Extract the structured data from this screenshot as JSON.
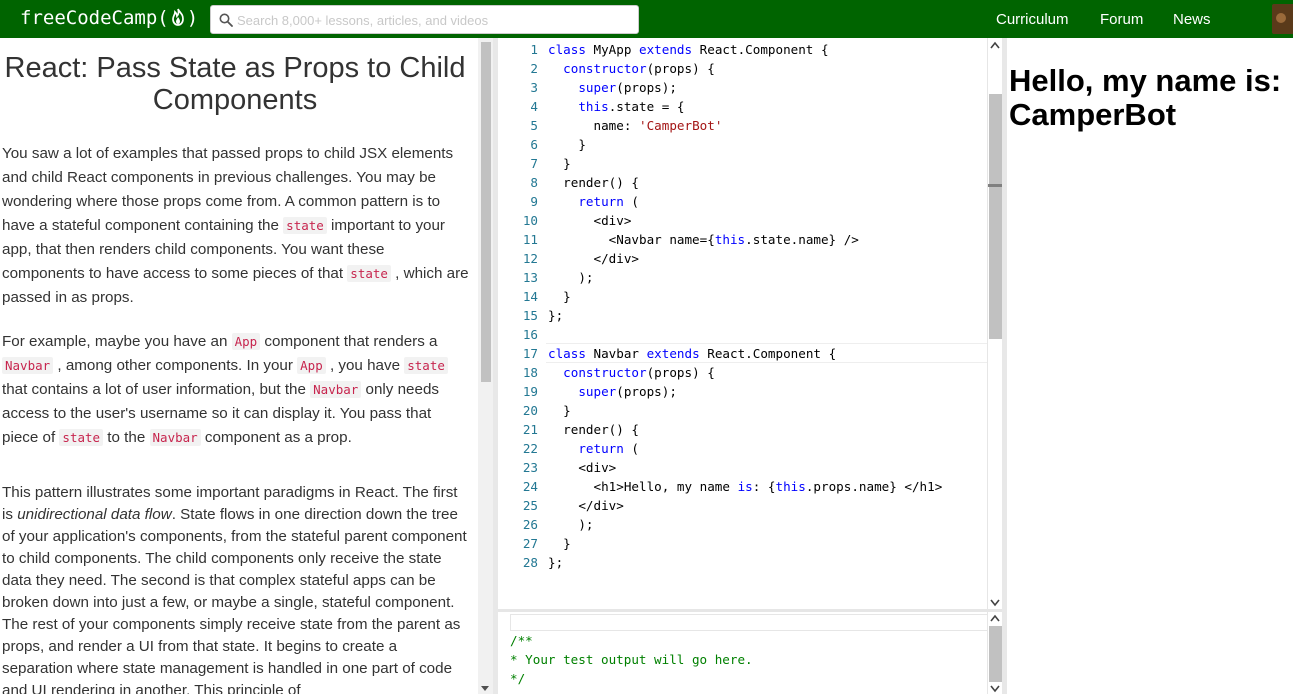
{
  "navbar": {
    "brand": "freeCodeCamp(",
    "brand_close": ")",
    "search_placeholder": "Search 8,000+ lessons, articles, and videos",
    "links": [
      "Curriculum",
      "Forum",
      "News"
    ],
    "colors": {
      "background": "#006400",
      "text": "#ffffff"
    }
  },
  "instructions": {
    "title": "React: Pass State as Props to Child Components",
    "p1": [
      "You saw a lot of examples that passed props to child JSX elements and child React components in previous challenges. You may be wondering where those props come from. A common pattern is to have a stateful component containing the ",
      "state",
      " important to your app, that then renders child components. You want these components to have access to some pieces of that ",
      "state",
      " , which are passed in as props."
    ],
    "p2": [
      "For example, maybe you have an ",
      "App",
      " component that renders a ",
      "Navbar",
      " , among other components. In your ",
      "App",
      " , you have ",
      "state",
      " that contains a lot of user information, but the ",
      "Navbar",
      " only needs access to the user's username so it can display it. You pass that piece of ",
      "state",
      " to the ",
      "Navbar",
      " component as a prop."
    ],
    "p3": [
      "This pattern illustrates some important paradigms in React. The first is ",
      "unidirectional data flow",
      ". State flows in one direction down the tree of your application's components, from the stateful parent component to child components. The child components only receive the state data they need. The second is that complex stateful apps can be broken down into just a few, or maybe a single, stateful component. The rest of your components simply receive state from the parent as props, and render a UI from that state. It begins to create a separation where state management is handled in one part of code and UI rendering in another. This principle of"
    ],
    "code_color": "#c7254e"
  },
  "editor": {
    "lines": [
      [
        "class",
        " MyApp ",
        "extends",
        " React.Component {"
      ],
      [
        "  constructor(props) {"
      ],
      [
        "    super(props);"
      ],
      [
        "    this.state = {"
      ],
      [
        "      name: ",
        "'CamperBot'"
      ],
      [
        "    }"
      ],
      [
        "  }"
      ],
      [
        "  render() {"
      ],
      [
        "    return ("
      ],
      [
        "      <div>"
      ],
      [
        "        <Navbar name={this.state.name} />"
      ],
      [
        "      </div>"
      ],
      [
        "    );"
      ],
      [
        "  }"
      ],
      [
        "};"
      ],
      [
        ""
      ],
      [
        "class",
        " Navbar ",
        "extends",
        " React.Component {"
      ],
      [
        "  constructor(props) {"
      ],
      [
        "    super(props);"
      ],
      [
        "  }"
      ],
      [
        "  render() {"
      ],
      [
        "    return ("
      ],
      [
        "    <div>"
      ],
      [
        "      <h1>Hello, my name is: {this.props.name} </h1>"
      ],
      [
        "    </div>"
      ],
      [
        "    );"
      ],
      [
        "  }"
      ],
      [
        "};"
      ]
    ],
    "line_number_color": "#237893",
    "keyword_color": "#0000ff",
    "string_color": "#a31515"
  },
  "output": {
    "lines": [
      "/**",
      "* Your test output will go here.",
      "*/"
    ],
    "color": "#008000"
  },
  "preview": {
    "heading": "Hello, my name is: CamperBot"
  }
}
